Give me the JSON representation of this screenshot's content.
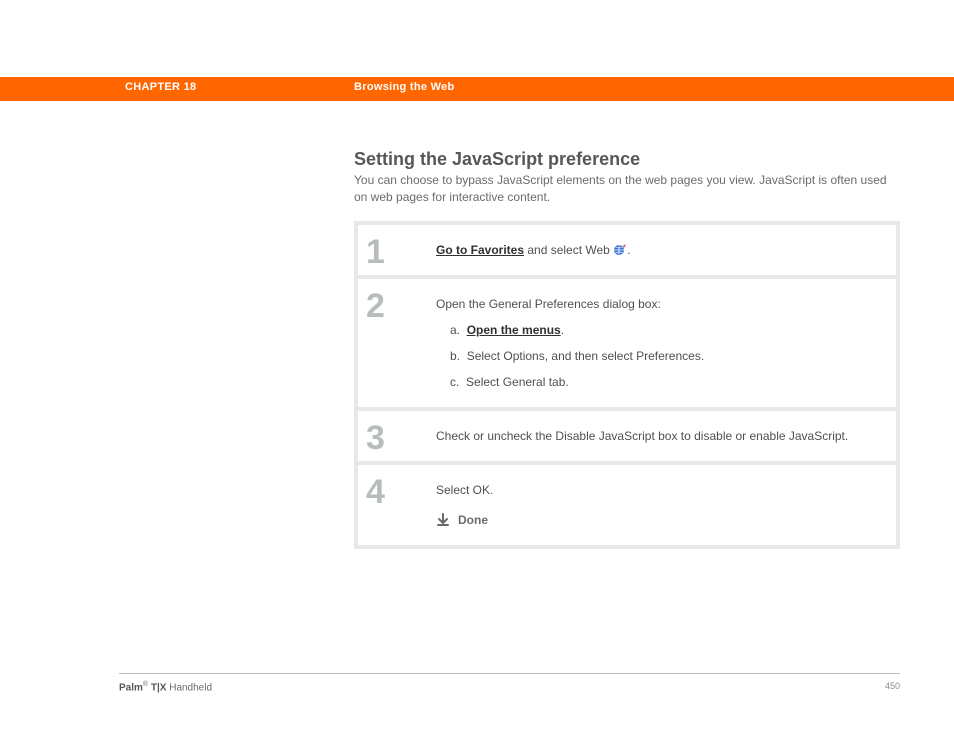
{
  "header": {
    "chapter": "CHAPTER 18",
    "breadcrumb": "Browsing the Web"
  },
  "section": {
    "title": "Setting the JavaScript preference",
    "intro": "You can choose to bypass JavaScript elements on the web pages you view. JavaScript is often used on web pages for interactive content."
  },
  "steps": [
    {
      "num": "1",
      "link": "Go to Favorites",
      "after_link": " and select Web ",
      "period": "."
    },
    {
      "num": "2",
      "lead": "Open the General Preferences dialog box:",
      "a_label": "a.",
      "a_link": "Open the menus",
      "a_period": ".",
      "b_label": "b.",
      "b_text": "Select Options, and then select Preferences.",
      "c_label": "c.",
      "c_text": "Select General tab."
    },
    {
      "num": "3",
      "text": "Check or uncheck the Disable JavaScript box to disable or enable JavaScript."
    },
    {
      "num": "4",
      "text": "Select OK.",
      "done": "Done"
    }
  ],
  "footer": {
    "brand": "Palm",
    "reg": "®",
    "model": " T|X",
    "product": " Handheld",
    "page": "450"
  }
}
